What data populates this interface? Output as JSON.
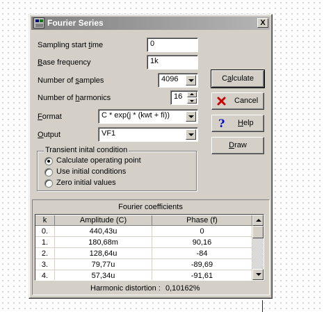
{
  "window": {
    "title": "Fourier Series",
    "close_label": "X"
  },
  "form": {
    "sampling_start_time": {
      "label_pre": "Sampling start ",
      "label_acc": "t",
      "label_post": "ime",
      "value": "0"
    },
    "base_frequency": {
      "label_pre": "",
      "label_acc": "B",
      "label_post": "ase frequency",
      "value": "1k"
    },
    "number_of_samples": {
      "label_pre": "Number of ",
      "label_acc": "s",
      "label_post": "amples",
      "value": "4096"
    },
    "number_of_harmonics": {
      "label_pre": "Number of ",
      "label_acc": "h",
      "label_post": "armonics",
      "value": "16"
    },
    "format": {
      "label_pre": "",
      "label_acc": "F",
      "label_post": "ormat",
      "value": "C * exp(j * (kwt + fi))"
    },
    "output": {
      "label_pre": "",
      "label_acc": "O",
      "label_post": "utput",
      "value": "VF1"
    }
  },
  "buttons": {
    "calculate": {
      "pre": "C",
      "acc": "a",
      "post": "lculate"
    },
    "cancel": {
      "label": "Cancel"
    },
    "help": {
      "pre": "",
      "acc": "H",
      "post": "elp"
    },
    "draw": {
      "pre": "",
      "acc": "D",
      "post": "raw"
    }
  },
  "transient": {
    "title": "Transient inital condition",
    "options": [
      {
        "label": "Calculate operating point",
        "selected": true
      },
      {
        "label": "Use initial conditions",
        "selected": false
      },
      {
        "label": "Zero initial values",
        "selected": false
      }
    ]
  },
  "coefficients": {
    "title": "Fourier coefficients",
    "columns": [
      "k",
      "Amplitude (C)",
      "Phase (f)"
    ],
    "rows": [
      [
        "0.",
        "440,43u",
        "0"
      ],
      [
        "1.",
        "180,68m",
        "90,16"
      ],
      [
        "2.",
        "128,64u",
        "-84"
      ],
      [
        "3.",
        "79,77u",
        "-89,69"
      ],
      [
        "4.",
        "57,34u",
        "-91,61"
      ]
    ],
    "distortion_label": "Harmonic distortion :",
    "distortion_value": "0,10162%"
  },
  "colors": {
    "cancel_icon": "#cc0000",
    "help_icon": "#0000cc",
    "titlebar": "#808080"
  }
}
